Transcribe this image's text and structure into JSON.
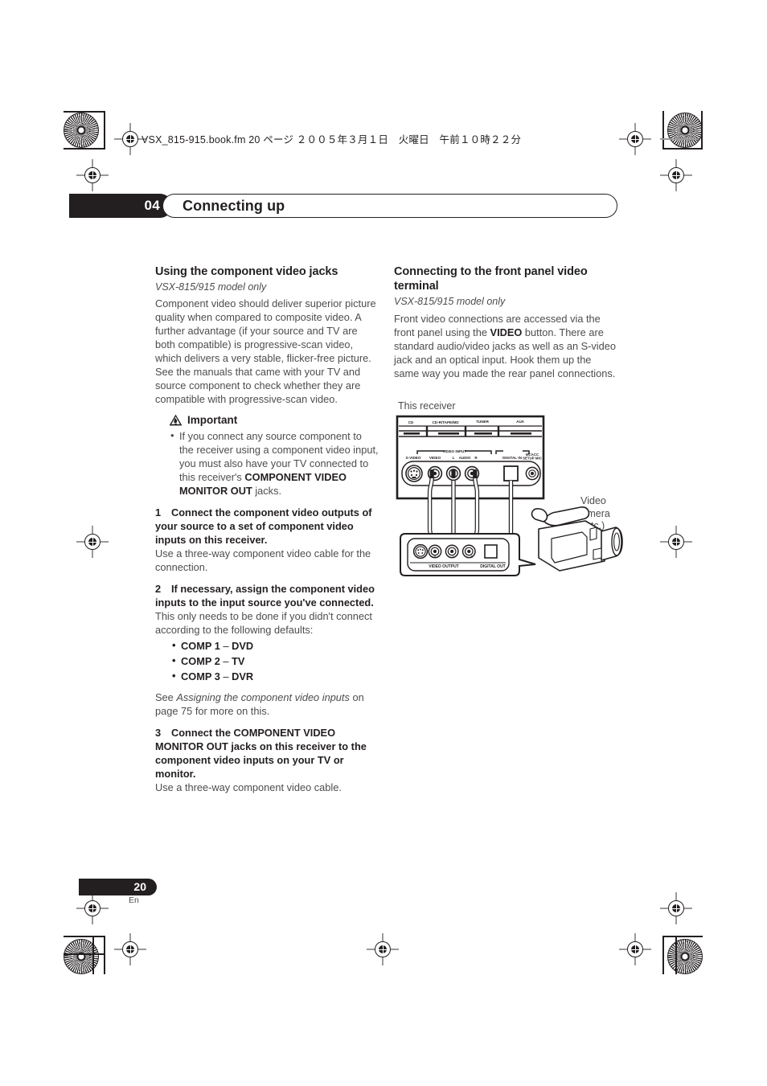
{
  "header": {
    "filepath_line": "VSX_815-915.book.fm  20 ページ  ２００５年３月１日　火曜日　午前１０時２２分",
    "chapter_number": "04",
    "chapter_title": "Connecting up"
  },
  "left_column": {
    "heading": "Using the component video jacks",
    "model_note": "VSX-815/915 model only",
    "intro": "Component video should deliver superior picture quality when compared to composite video. A further advantage (if your source and TV are both compatible) is progressive-scan video, which delivers a very stable, flicker-free picture. See the manuals that came with your TV and source component to check whether they are compatible with progressive-scan video.",
    "important_label": "Important",
    "important_bullet_pre": "If you connect any source component to the receiver using a component video input, you must also have your TV connected to this receiver's ",
    "important_bullet_bold": "COMPONENT VIDEO MONITOR OUT",
    "important_bullet_post": " jacks.",
    "steps": [
      {
        "number": "1",
        "title": "Connect the component video outputs of your source to a set of component video inputs on this receiver.",
        "body": "Use a three-way component video cable for the connection."
      },
      {
        "number": "2",
        "title": "If necessary, assign the component video inputs to the input source you've connected.",
        "body": "This only needs to be done if you didn't connect according to the following defaults:"
      },
      {
        "number": "3",
        "title": "Connect the COMPONENT VIDEO MONITOR OUT jacks on this receiver to the component video inputs on your TV or monitor.",
        "body": "Use a three-way component video cable."
      }
    ],
    "comp_defaults": [
      {
        "input": "COMP 1",
        "dash": "–",
        "source": "DVD"
      },
      {
        "input": "COMP 2",
        "dash": "–",
        "source": "TV"
      },
      {
        "input": "COMP 3",
        "dash": "–",
        "source": "DVR"
      }
    ],
    "see_ref_pre": "See ",
    "see_ref_italic": "Assigning the component video inputs",
    "see_ref_post": " on page 75 for more on this."
  },
  "right_column": {
    "heading": "Connecting to the front panel video terminal",
    "model_note": "VSX-815/915 model only",
    "intro_pre": "Front video connections are accessed via the front panel using the ",
    "intro_bold": "VIDEO",
    "intro_post": " button. There are standard audio/video jacks as well as an S-video jack and an optical input. Hook them up the same way you made the rear panel connections."
  },
  "diagram": {
    "receiver_caption": "This receiver",
    "camera_caption": "Video camera (etc.)",
    "receiver_top_labels": [
      "CD",
      "CD-R/TAPE/MD",
      "TUNER",
      "AUX"
    ],
    "receiver_group_label": "VIDEO INPUT",
    "receiver_jack_labels": [
      "S-VIDEO",
      "VIDEO",
      "L",
      "AUDIO",
      "R"
    ],
    "receiver_digital_label": "DIGITAL IN",
    "receiver_mic_label": "MCACC SETUP MIC",
    "device_video_label": "VIDEO OUTPUT",
    "device_digital_label": "DIGITAL OUT"
  },
  "footer": {
    "page_number": "20",
    "language": "En"
  },
  "colors": {
    "ink": "#231f20",
    "body_text": "#4d4d4d",
    "reg_gray": "#9a9a9a"
  }
}
